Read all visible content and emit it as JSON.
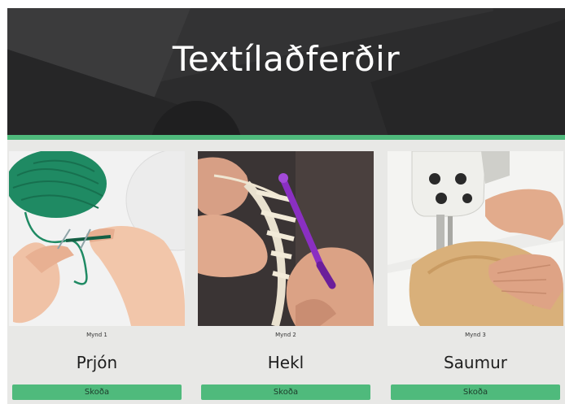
{
  "header": {
    "title": "Textílaðferðir"
  },
  "colors": {
    "accent": "#4fba7c",
    "hero_bg": "#2c2c2d",
    "page_bg": "#e8e8e6"
  },
  "cards": [
    {
      "caption": "Mynd 1",
      "title": "Prjón",
      "button": "Skoða",
      "image": "knitting-photo"
    },
    {
      "caption": "Mynd 2",
      "title": "Hekl",
      "button": "Skoða",
      "image": "crochet-photo"
    },
    {
      "caption": "Mynd 3",
      "title": "Saumur",
      "button": "Skoða",
      "image": "sewing-machine-photo"
    }
  ]
}
